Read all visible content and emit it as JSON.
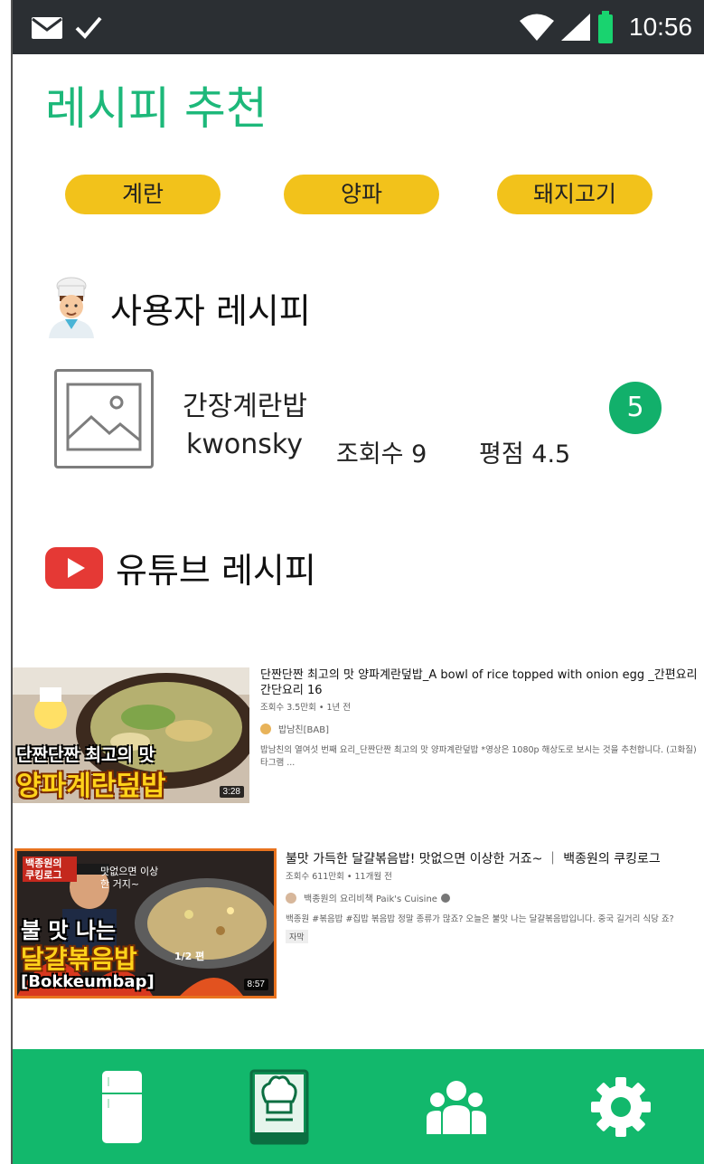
{
  "status_bar": {
    "time": "10:56"
  },
  "page_title": "레시피 추천",
  "ingredient_chips": [
    "계란",
    "양파",
    "돼지고기"
  ],
  "sections": {
    "user_recipes": "사용자 레시피",
    "youtube_recipes": "유튜브 레시피"
  },
  "user_recipe": {
    "name": "간장계란밥",
    "author": "kwonsky",
    "views": "조회수 9",
    "rating": "평점 4.5",
    "badge_count": "5"
  },
  "videos": [
    {
      "title": "단짠단짠 최고의 맛 양파계란덮밥_A bowl of rice topped with onion egg _간편요리 간단요리 16",
      "meta": "조회수 3.5만회 • 1년 전",
      "channel": "밥남친[BAB]",
      "description": "밥남친의 열여섯 번째 요리_단짠단짠 최고의 맛 양파계란덮밥 *영상은 1080p 해상도로 보시는 것을 추천합니다. (고화질) 타그램 ...",
      "duration": "3:28",
      "thumb_line1": "단짠단짠 최고의 맛",
      "thumb_line2": "양파계란덮밥"
    },
    {
      "title": "불맛 가득한 달걀볶음밥! 맛없으면 이상한 거죠~ ｜ 백종원의 쿠킹로그",
      "meta": "조회수 611만회 • 11개월 전",
      "channel": "백종원의 요리비책 Paik's Cuisine",
      "description": "백종원 #볶음밥 #집밥 볶음밥 정말 종류가 많죠? 오늘은 불맛 나는 달걀볶음밥입니다. 중국 길거리 식당 죠?",
      "tag": "자막",
      "duration": "8:57",
      "thumb_line1": "불 맛 나는",
      "thumb_line2": "달걀볶음밥",
      "thumb_line3": "[Bokkeumbap]",
      "thumb_corner": "백종원의 쿠킹로그",
      "thumb_bubble": "맛없으면 이상한 거지~",
      "thumb_part": "1/2 편"
    }
  ],
  "colors": {
    "accent_green": "#1db87a",
    "nav_green": "#12b86c",
    "chip_yellow": "#f2c21b",
    "youtube_red": "#e53935",
    "status_bar": "#2b2f33"
  },
  "icons": {
    "status": [
      "mail-icon",
      "check-icon",
      "wifi-icon",
      "signal-icon",
      "battery-icon"
    ],
    "nav": [
      "fridge-icon",
      "recipe-book-icon",
      "community-icon",
      "settings-icon"
    ]
  }
}
